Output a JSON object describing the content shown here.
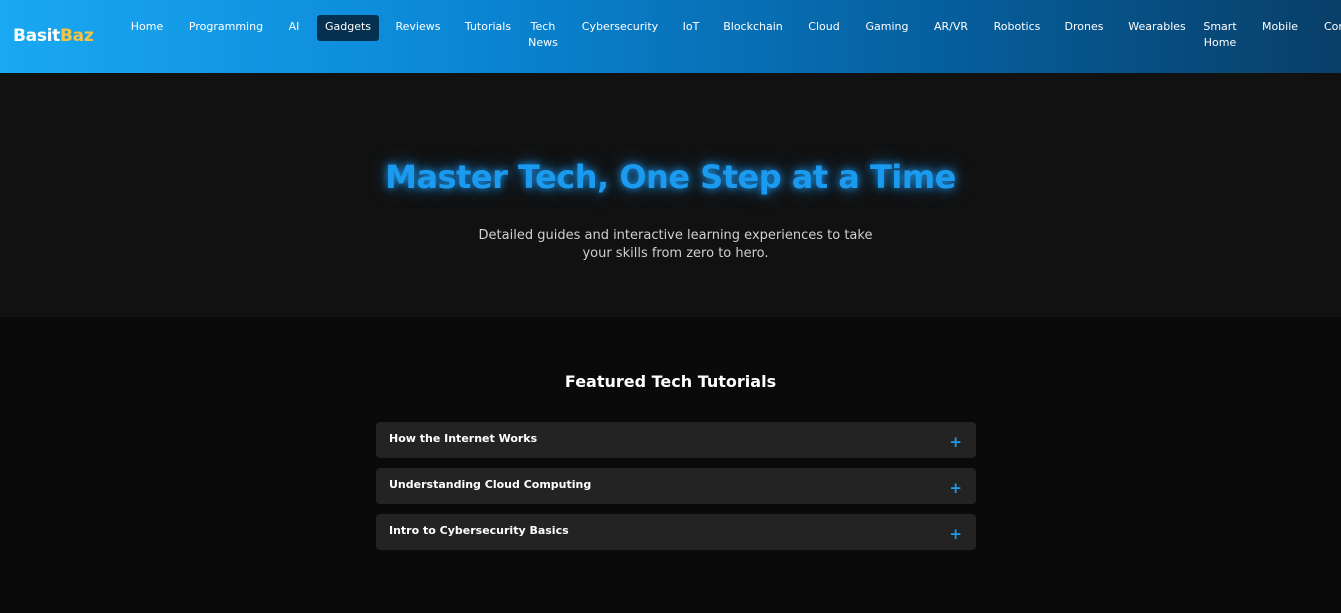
{
  "brand": {
    "part1": "Basit",
    "part2": "Baz",
    "part1_color": "#ffffff",
    "part2_color": "#f4c542"
  },
  "nav": {
    "items": [
      {
        "label": "Home"
      },
      {
        "label": "Programming"
      },
      {
        "label": "AI"
      },
      {
        "label": "Gadgets",
        "active": true
      },
      {
        "label": "Reviews"
      },
      {
        "label": "Tutorials"
      },
      {
        "label": "Tech News"
      },
      {
        "label": "Cybersecurity"
      },
      {
        "label": "IoT"
      },
      {
        "label": "Blockchain"
      },
      {
        "label": "Cloud"
      },
      {
        "label": "Gaming"
      },
      {
        "label": "AR/VR"
      },
      {
        "label": "Robotics"
      },
      {
        "label": "Drones"
      },
      {
        "label": "Wearables"
      },
      {
        "label": "Smart Home"
      },
      {
        "label": "Mobile"
      },
      {
        "label": "Cor"
      }
    ]
  },
  "hero": {
    "title": "Master Tech, One Step at a Time",
    "subtitle": "Detailed guides and interactive learning experiences to take your skills from zero to hero."
  },
  "featured": {
    "title": "Featured Tech Tutorials",
    "items": [
      {
        "label": "How the Internet Works",
        "icon": "plus-icon",
        "symbol": "+"
      },
      {
        "label": "Understanding Cloud Computing",
        "icon": "plus-icon",
        "symbol": "+"
      },
      {
        "label": "Intro to Cybersecurity Basics",
        "icon": "plus-icon",
        "symbol": "+"
      }
    ]
  },
  "colors": {
    "accent": "#1b9bf0",
    "header_gradient_start": "#1aa8f2",
    "header_gradient_end": "#083f68",
    "active_nav_bg": "#06304f",
    "hero_bg": "#111111",
    "section_bg": "#0a0a0a",
    "card_bg": "#232323"
  }
}
